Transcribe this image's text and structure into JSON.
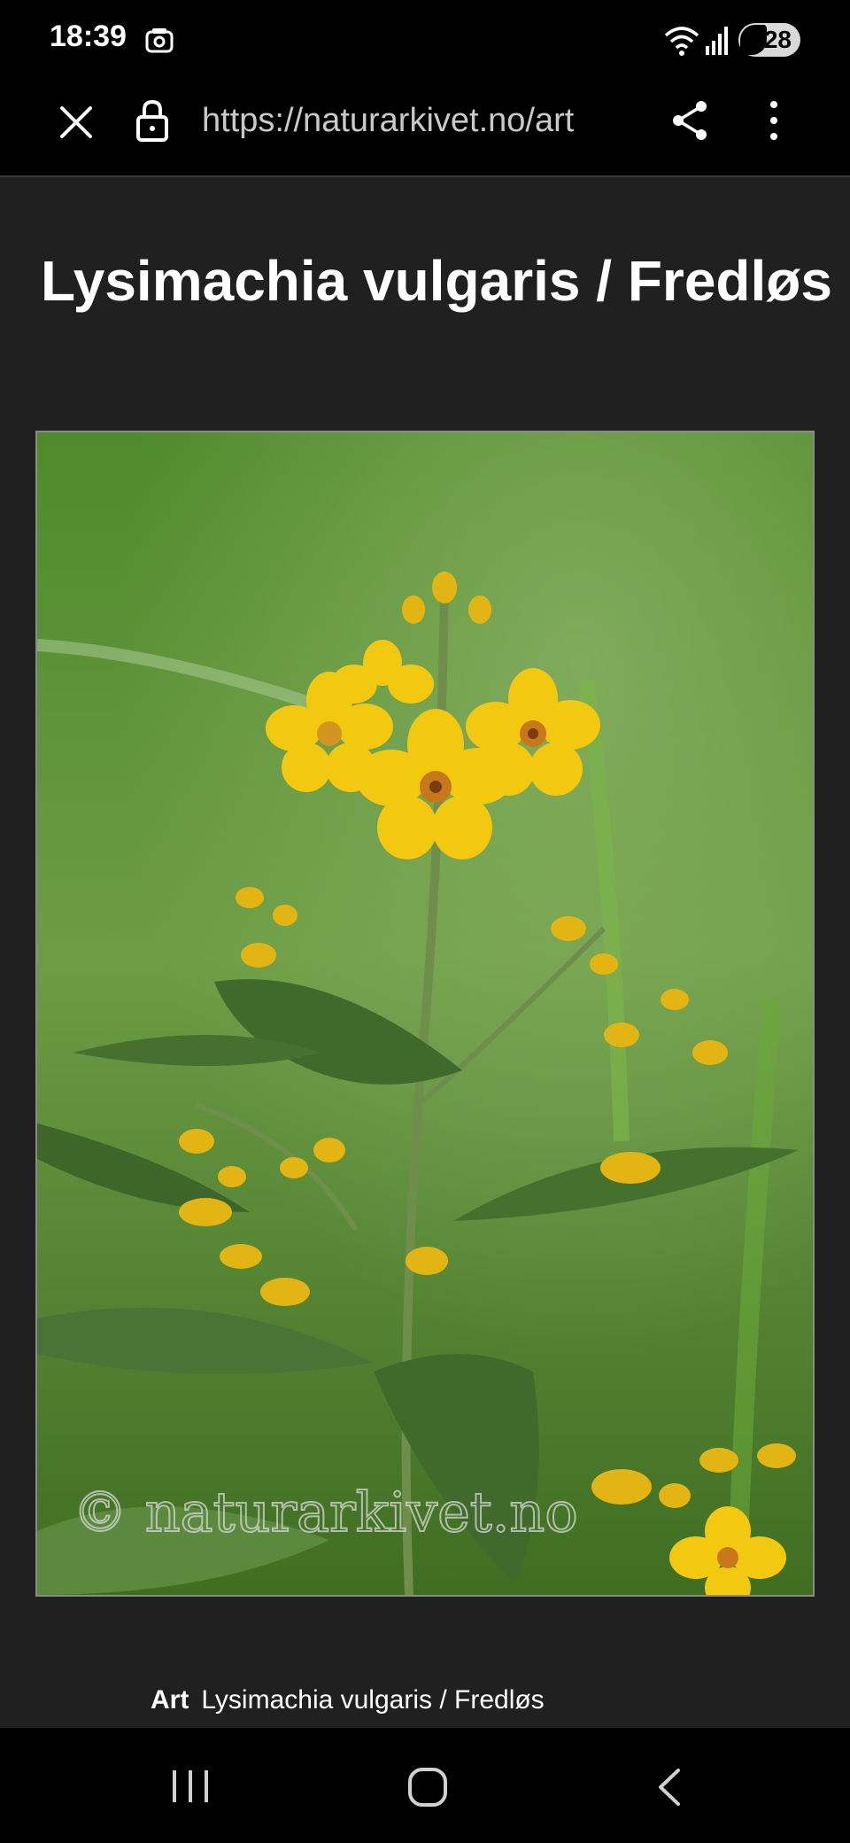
{
  "status_bar": {
    "time": "18:39",
    "battery_level": "28",
    "icons": [
      "screen-record-icon",
      "wifi-icon",
      "signal-icon",
      "battery-saver-icon"
    ]
  },
  "browser": {
    "url": "https://naturarkivet.no/art",
    "icons": [
      "close-icon",
      "lock-icon",
      "share-icon",
      "more-vert-icon"
    ]
  },
  "page": {
    "title": "Lysimachia vulgaris / Fredløs",
    "photo_watermark": "© naturarkivet.no",
    "caption_label": "Art",
    "caption_value": "Lysimachia vulgaris / Fredløs"
  },
  "nav_bar": {
    "icons": [
      "recent-apps-icon",
      "home-icon",
      "back-icon"
    ]
  },
  "colors": {
    "page_background": "#202020",
    "bars_background": "#000000",
    "flower_yellow": "#f2c811",
    "foliage_green": "#4e7d2e"
  }
}
